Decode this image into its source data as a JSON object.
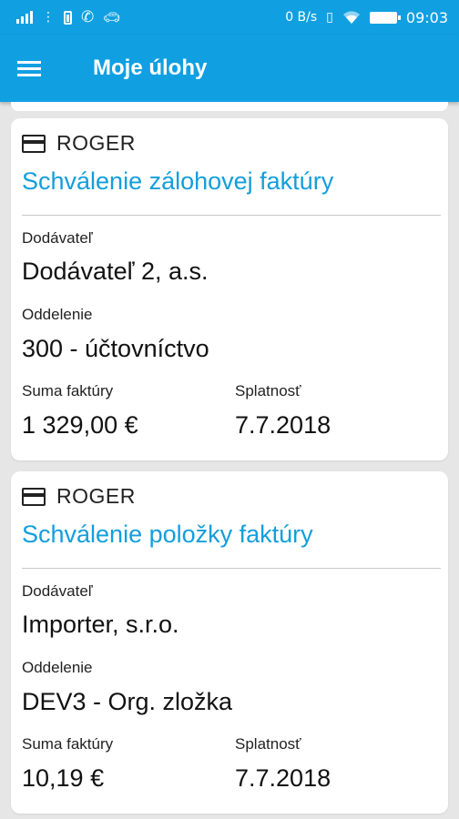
{
  "status_bar": {
    "net_speed": "0 B/s",
    "time": "09:03",
    "icons": [
      "signal-icon",
      "more-icon",
      "battery-saver-icon",
      "wifi-call-icon",
      "car-icon",
      "vibrate-icon",
      "wifi-icon",
      "battery-icon"
    ]
  },
  "app_bar": {
    "title": "Moje úlohy",
    "menu_icon": "menu-icon",
    "color": "#10a0e2"
  },
  "tasks": [
    {
      "source_icon": "credit-card-icon",
      "source": "ROGER",
      "title": "Schválenie zálohovej faktúry",
      "supplier_label": "Dodávateľ",
      "supplier": "Dodávateľ 2, a.s.",
      "department_label": "Oddelenie",
      "department": "300 - účtovníctvo",
      "amount_label": "Suma faktúry",
      "amount": "1 329,00 €",
      "due_label": "Splatnosť",
      "due": "7.7.2018"
    },
    {
      "source_icon": "credit-card-icon",
      "source": "ROGER",
      "title": "Schválenie položky faktúry",
      "supplier_label": "Dodávateľ",
      "supplier": "Importer, s.r.o.",
      "department_label": "Oddelenie",
      "department": "DEV3 - Org. zložka",
      "amount_label": "Suma faktúry",
      "amount": "10,19 €",
      "due_label": "Splatnosť",
      "due": "7.7.2018"
    }
  ],
  "colors": {
    "accent": "#10a0e2",
    "title_text": "#139edc",
    "background": "#e6e6e6"
  }
}
